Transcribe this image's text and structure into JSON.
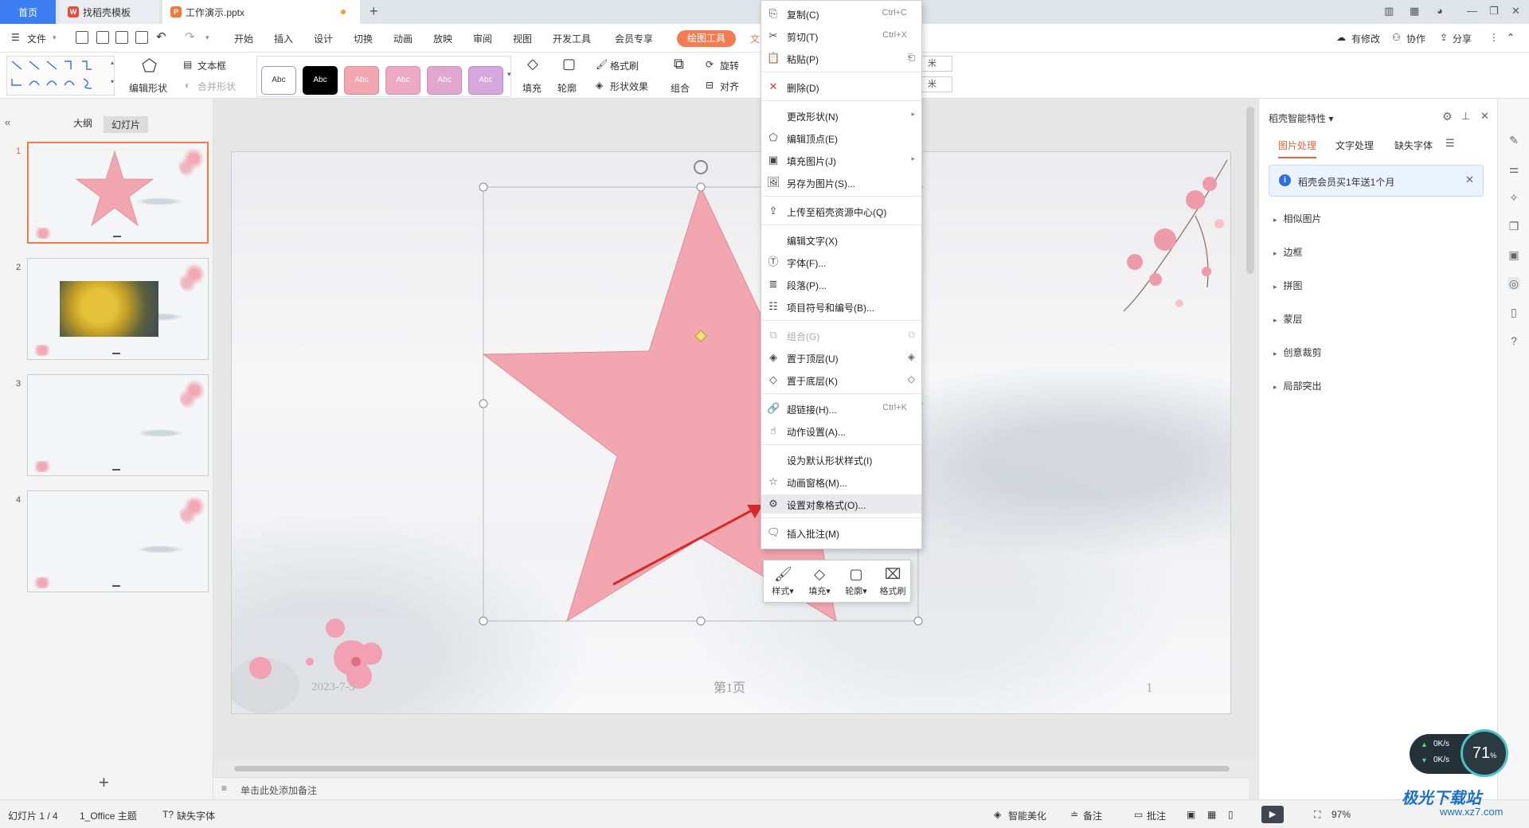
{
  "titlebar": {
    "tabs": [
      {
        "label": "首页"
      },
      {
        "label": "找稻壳模板"
      },
      {
        "label": "工作演示.pptx"
      }
    ],
    "new_tab": "+"
  },
  "menubar": {
    "file": "文件",
    "items": [
      "开始",
      "插入",
      "设计",
      "切换",
      "动画",
      "放映",
      "审阅",
      "视图",
      "开发工具",
      "会员专享"
    ],
    "drawing_tools": "绘图工具",
    "text_tools_partial": "文",
    "right": {
      "modified": "有修改",
      "collaborate": "协作",
      "share": "分享"
    }
  },
  "ribbon": {
    "edit_shape": "编辑形状",
    "text_box": "文本框",
    "merge_shape": "合并形状",
    "style_samples": [
      "Abc",
      "Abc",
      "Abc",
      "Abc",
      "Abc",
      "Abc"
    ],
    "fill": "填充",
    "outline": "轮廓",
    "format_painter": "格式刷",
    "shape_effect": "形状效果",
    "group": "组合",
    "rotate": "旋转",
    "align": "对齐",
    "unit1": "米",
    "unit2": "米"
  },
  "left_panel": {
    "tabs": [
      "大纲",
      "幻灯片"
    ],
    "slides": [
      "1",
      "2",
      "3",
      "4"
    ],
    "add": "+"
  },
  "slide": {
    "date": "2023-7-5",
    "page_label": "第1页",
    "page_number": "1"
  },
  "context_menu": {
    "items": [
      {
        "label": "复制(C)",
        "shortcut": "Ctrl+C"
      },
      {
        "label": "剪切(T)",
        "shortcut": "Ctrl+X"
      },
      {
        "label": "粘贴(P)"
      },
      {
        "label": "删除(D)"
      },
      {
        "label": "更改形状(N)"
      },
      {
        "label": "编辑顶点(E)"
      },
      {
        "label": "填充图片(J)"
      },
      {
        "label": "另存为图片(S)..."
      },
      {
        "label": "上传至稻壳资源中心(Q)"
      },
      {
        "label": "编辑文字(X)"
      },
      {
        "label": "字体(F)..."
      },
      {
        "label": "段落(P)..."
      },
      {
        "label": "项目符号和编号(B)..."
      },
      {
        "label": "组合(G)"
      },
      {
        "label": "置于顶层(U)"
      },
      {
        "label": "置于底层(K)"
      },
      {
        "label": "超链接(H)...",
        "shortcut": "Ctrl+K"
      },
      {
        "label": "动作设置(A)..."
      },
      {
        "label": "设为默认形状样式(I)"
      },
      {
        "label": "动画窗格(M)..."
      },
      {
        "label": "设置对象格式(O)..."
      },
      {
        "label": "插入批注(M)"
      }
    ]
  },
  "mini_toolbar": {
    "style": "样式",
    "fill": "填充",
    "outline": "轮廓",
    "format_painter": "格式刷"
  },
  "right_panel": {
    "title": "稻壳智能特性",
    "tabs": [
      "图片处理",
      "文字处理",
      "缺失字体"
    ],
    "banner": "稻壳会员买1年送1个月",
    "items": [
      "相似图片",
      "边框",
      "拼图",
      "蒙层",
      "创意裁剪",
      "局部突出"
    ]
  },
  "notes": {
    "placeholder": "单击此处添加备注"
  },
  "statusbar": {
    "slide_count": "幻灯片 1 / 4",
    "theme": "1_Office 主题",
    "missing_font": "缺失字体",
    "smart_beautify": "智能美化",
    "notes": "备注",
    "comment": "批注",
    "zoom": "97%"
  },
  "network": {
    "up": "0K/s",
    "down": "0K/s",
    "percent": "71",
    "percent_sign": "%"
  },
  "watermark": {
    "name": "极光下载站",
    "url": "www.xz7.com"
  },
  "colors": {
    "accent": "#3d7ff3",
    "drawing_tab": "#f57c52",
    "star_fill": "#f2a6b0",
    "arrow": "#d42a2a",
    "selection_accent": "#e8623b"
  }
}
